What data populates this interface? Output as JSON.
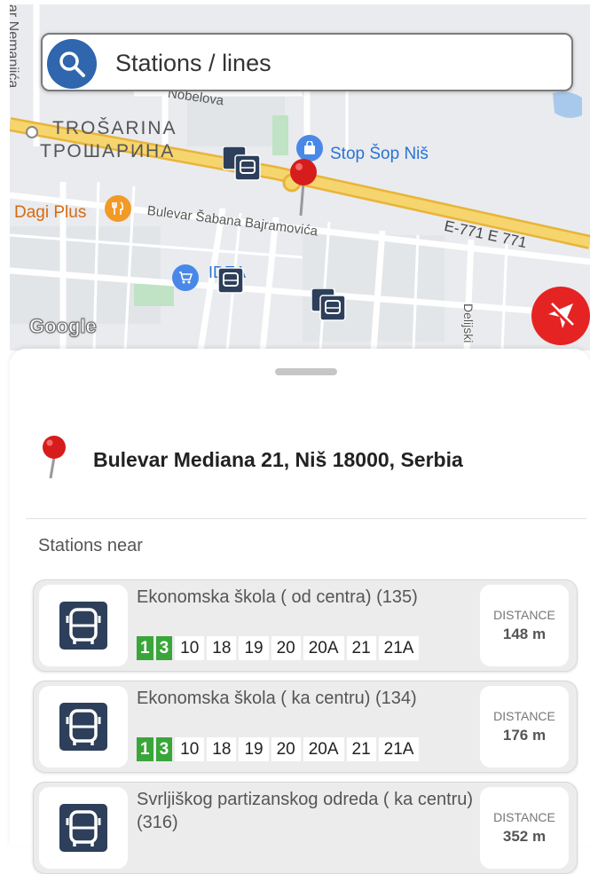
{
  "map": {
    "labels": {
      "street_nemanjica": "ar Nemanjića",
      "nobelova": "Nobelova",
      "trosarina_latin": "TROŠARINA",
      "trosarina_cyrillic": "ТРОШАРИНА",
      "stop_shop": "Stop Šop Niš",
      "dagi_plus": "Dagi Plus",
      "bulevar_sabana": "Bulevar Šabana Bajramovića",
      "e771": "E-771  E 771",
      "idea": "IDEA",
      "deliji": "Delijski",
      "google": "Google"
    },
    "icons": {
      "search": "search-icon",
      "compass": "navigation-arrow-icon",
      "location_pin": "location-pin-icon",
      "bus_stop": "bus-stop-marker-icon",
      "restaurant": "restaurant-icon",
      "shopping": "shopping-bag-icon",
      "cart": "shopping-cart-icon"
    }
  },
  "search": {
    "label": "Stations / lines"
  },
  "sheet": {
    "address": "Bulevar Mediana 21, Niš 18000, Serbia",
    "section_title": "Stations near",
    "stations": [
      {
        "name": "Ekonomska škola ( od centra) (135)",
        "lines": [
          "1",
          "3",
          "10",
          "18",
          "19",
          "20",
          "20A",
          "21",
          "21A"
        ],
        "highlight_lines": [
          "1",
          "3"
        ],
        "distance_label": "DISTANCE",
        "distance": "148 m"
      },
      {
        "name": "Ekonomska škola ( ka centru) (134)",
        "lines": [
          "1",
          "3",
          "10",
          "18",
          "19",
          "20",
          "20A",
          "21",
          "21A"
        ],
        "highlight_lines": [
          "1",
          "3"
        ],
        "distance_label": "DISTANCE",
        "distance": "176 m"
      },
      {
        "name": "Svrljiškog partizanskog odreda ( ka centru) (316)",
        "lines": [],
        "highlight_lines": [],
        "distance_label": "DISTANCE",
        "distance": "352 m"
      }
    ]
  },
  "colors": {
    "accent_blue": "#2f66ad",
    "compass_red": "#e52323",
    "line_green": "#3aa63a",
    "bus_icon_bg": "#2d3f5a",
    "highway": "#f2c94c"
  }
}
